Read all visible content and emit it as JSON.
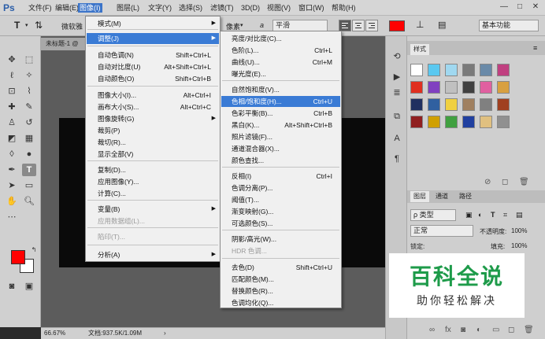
{
  "menubar": {
    "logo": "Ps",
    "items": [
      "文件(F)",
      "编辑(E)",
      "图像(I)",
      "图层(L)",
      "文字(Y)",
      "选择(S)",
      "滤镜(T)",
      "3D(D)",
      "视图(V)",
      "窗口(W)",
      "帮助(H)"
    ],
    "window_controls": [
      "—",
      "□",
      "✕"
    ]
  },
  "optbar": {
    "tool_glyph": "T",
    "font_family": "微软雅",
    "font_style": "像素",
    "aa_label": "a",
    "aa_value": "平滑",
    "color_hex": "#ff0000",
    "workspace": "基本功能"
  },
  "document": {
    "tab_title": "未标题-1 @",
    "zoom": "66.67%",
    "doc_info": "文档:937.5K/1.09M"
  },
  "image_menu": {
    "items": [
      {
        "label": "模式(M)",
        "shortcut": "",
        "submenu": true
      },
      {
        "label": "调整(J)",
        "shortcut": "",
        "submenu": true,
        "highlight": true
      },
      {
        "label": "自动色调(N)",
        "shortcut": "Shift+Ctrl+L"
      },
      {
        "label": "自动对比度(U)",
        "shortcut": "Alt+Shift+Ctrl+L"
      },
      {
        "label": "自动颜色(O)",
        "shortcut": "Shift+Ctrl+B"
      },
      {
        "label": "图像大小(I)...",
        "shortcut": "Alt+Ctrl+I"
      },
      {
        "label": "画布大小(S)...",
        "shortcut": "Alt+Ctrl+C"
      },
      {
        "label": "图像旋转(G)",
        "shortcut": "",
        "submenu": true
      },
      {
        "label": "裁剪(P)",
        "shortcut": ""
      },
      {
        "label": "裁切(R)...",
        "shortcut": ""
      },
      {
        "label": "显示全部(V)",
        "shortcut": ""
      },
      {
        "label": "复制(D)...",
        "shortcut": ""
      },
      {
        "label": "应用图像(Y)...",
        "shortcut": ""
      },
      {
        "label": "计算(C)...",
        "shortcut": ""
      },
      {
        "label": "变量(B)",
        "shortcut": "",
        "submenu": true
      },
      {
        "label": "应用数据组(L)...",
        "shortcut": "",
        "disabled": true
      },
      {
        "label": "陷印(T)...",
        "shortcut": "",
        "disabled": true
      },
      {
        "label": "分析(A)",
        "shortcut": "",
        "submenu": true
      }
    ]
  },
  "adjust_menu": {
    "items": [
      {
        "label": "亮度/对比度(C)...",
        "shortcut": ""
      },
      {
        "label": "色阶(L)...",
        "shortcut": "Ctrl+L"
      },
      {
        "label": "曲线(U)...",
        "shortcut": "Ctrl+M"
      },
      {
        "label": "曝光度(E)...",
        "shortcut": ""
      },
      {
        "label": "自然饱和度(V)...",
        "shortcut": ""
      },
      {
        "label": "色相/饱和度(H)...",
        "shortcut": "Ctrl+U",
        "highlight": true
      },
      {
        "label": "色彩平衡(B)...",
        "shortcut": "Ctrl+B"
      },
      {
        "label": "黑白(K)...",
        "shortcut": "Alt+Shift+Ctrl+B"
      },
      {
        "label": "照片滤镜(F)...",
        "shortcut": ""
      },
      {
        "label": "通道混合器(X)...",
        "shortcut": ""
      },
      {
        "label": "颜色查找...",
        "shortcut": ""
      },
      {
        "label": "反相(I)",
        "shortcut": "Ctrl+I"
      },
      {
        "label": "色调分离(P)...",
        "shortcut": ""
      },
      {
        "label": "阈值(T)...",
        "shortcut": ""
      },
      {
        "label": "渐变映射(G)...",
        "shortcut": ""
      },
      {
        "label": "可选颜色(S)...",
        "shortcut": ""
      },
      {
        "label": "阴影/高光(W)...",
        "shortcut": ""
      },
      {
        "label": "HDR 色调...",
        "shortcut": "",
        "disabled": true
      },
      {
        "label": "去色(D)",
        "shortcut": "Shift+Ctrl+U"
      },
      {
        "label": "匹配颜色(M)...",
        "shortcut": ""
      },
      {
        "label": "替换颜色(R)...",
        "shortcut": ""
      },
      {
        "label": "色调均化(Q)...",
        "shortcut": ""
      }
    ]
  },
  "right": {
    "styles_tab": "样式",
    "layers_tabs": [
      "图层",
      "通道",
      "路径"
    ],
    "filter_kind": "ρ 类型",
    "blend_mode": "正常",
    "opacity_label": "不透明度:",
    "opacity_value": "100%",
    "lock_label": "锁定:",
    "fill_label": "填充:",
    "fill_value": "100%"
  },
  "watermark": {
    "title": "百科全说",
    "subtitle": "助你轻松解决"
  }
}
